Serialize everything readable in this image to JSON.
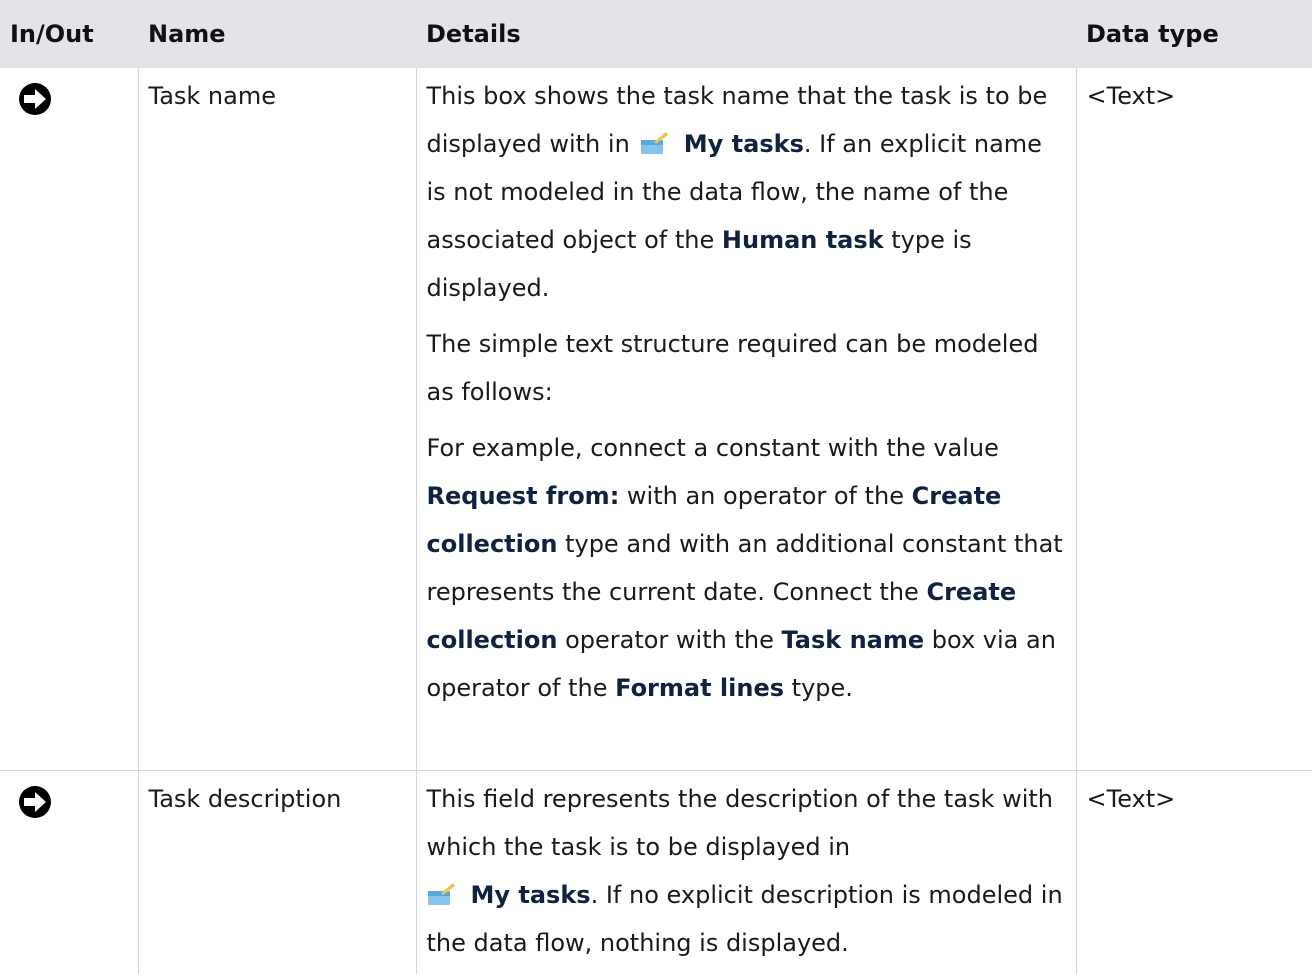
{
  "headers": {
    "in_out": "In/Out",
    "name": "Name",
    "details": "Details",
    "data_type": "Data type"
  },
  "rows": [
    {
      "direction_icon": "input-arrow-icon",
      "name": "Task name",
      "data_type": "<Text>",
      "p1": {
        "a": "This box shows the task name that the task is to be displayed with in",
        "icon": "my-tasks-icon",
        "b1": "My tasks",
        "c": ". If an explicit name is not modeled in the data flow, the name of the associated object of the",
        "b2": "Human task",
        "d": " type is displayed."
      },
      "p2": "The simple text structure required can be modeled as follows:",
      "p3": {
        "a": "For example, connect a constant with the value",
        "b1": "Request from:",
        "c": " with an operator of the",
        "b2": "Create collection",
        "d": " type and with an additional constant that represents the current date. Connect the",
        "b3": "Create collection",
        "e": " operator with the",
        "b4": "Task name",
        "f": " box via an operator of the",
        "b5": "Format lines",
        "g": " type."
      }
    },
    {
      "direction_icon": "input-arrow-icon",
      "name": "Task description",
      "data_type": "<Text>",
      "p1": {
        "a": "This field represents the description of the task with which the task is to be displayed in",
        "icon": "my-tasks-icon",
        "b1": "My tasks",
        "c": ". If no explicit description is modeled in the data flow, nothing is displayed."
      }
    }
  ],
  "colors": {
    "header_bg": "#e2e4e7",
    "bold_text": "#0f2240",
    "icon_blue": "#3a8fd0"
  }
}
